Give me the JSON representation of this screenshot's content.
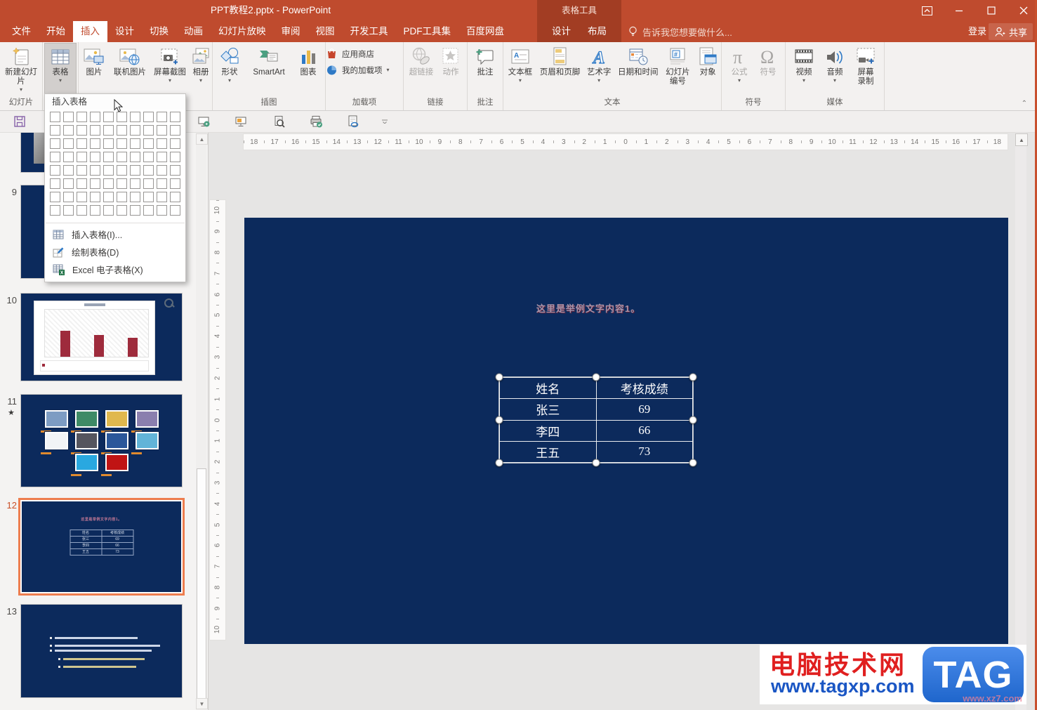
{
  "titlebar": {
    "title": "PPT教程2.pptx - PowerPoint",
    "contextual_label": "表格工具"
  },
  "tabs": {
    "items": [
      "文件",
      "开始",
      "插入",
      "设计",
      "切换",
      "动画",
      "幻灯片放映",
      "审阅",
      "视图",
      "开发工具",
      "PDF工具集",
      "百度网盘"
    ],
    "active": "插入",
    "contextual": [
      "设计",
      "布局"
    ],
    "tell_me": "告诉我您想要做什么...",
    "sign_in": "登录",
    "share": "共享"
  },
  "ribbon": {
    "groups": {
      "slides": "幻灯片",
      "illustrations": "插图",
      "addins": "加载项",
      "links": "链接",
      "comments": "批注",
      "text": "文本",
      "symbols": "符号",
      "media": "媒体"
    },
    "buttons": {
      "new_slide": "新建幻灯片",
      "table": "表格",
      "picture": "图片",
      "online_pictures": "联机图片",
      "screenshot": "屏幕截图",
      "photo_album": "相册",
      "shapes": "形状",
      "smartart": "SmartArt",
      "chart": "图表",
      "store": "应用商店",
      "my_addins": "我的加载项",
      "hyperlink": "超链接",
      "action": "动作",
      "comment": "批注",
      "text_box": "文本框",
      "header_footer": "页眉和页脚",
      "wordart": "艺术字",
      "date_time": "日期和时间",
      "slide_number": "幻灯片编号",
      "object": "对象",
      "equation": "公式",
      "symbol": "符号",
      "video": "视频",
      "audio": "音频",
      "screen_recording": "屏幕录制"
    }
  },
  "table_dropdown": {
    "header": "插入表格",
    "grid_cols": 10,
    "grid_rows": 8,
    "items": [
      "插入表格(I)...",
      "绘制表格(D)",
      "Excel 电子表格(X)"
    ]
  },
  "slide": {
    "title": "这里是举例文字内容1。",
    "table": {
      "headers": [
        "姓名",
        "考核成绩"
      ],
      "rows": [
        [
          "张三",
          "69"
        ],
        [
          "李四",
          "66"
        ],
        [
          "王五",
          "73"
        ]
      ]
    }
  },
  "thumbnails": [
    {
      "number": "",
      "type": "photo"
    },
    {
      "number": "9",
      "type": "blank"
    },
    {
      "number": "10",
      "type": "chart",
      "bars": [
        55,
        45,
        40
      ]
    },
    {
      "number": "11",
      "type": "gallery",
      "star": true,
      "colors": [
        "#7d9cc3",
        "#3e8a66",
        "#e0b84e",
        "#8a7fae",
        "#f2f4f6",
        "#55555e",
        "#2b579a",
        "#62b4d8",
        "#29a8e0",
        "#c01414"
      ]
    },
    {
      "number": "12",
      "type": "table",
      "selected": true
    },
    {
      "number": "13",
      "type": "bullets"
    }
  ],
  "rulers": {
    "h_origin": 18,
    "v_origin": 10
  },
  "watermark": {
    "site": "电脑技术网",
    "url": "www.tagxp.com",
    "logo": "TAG",
    "overlay_url": "www.xz7.com"
  },
  "colors": {
    "accent_red": "#bf4b2e",
    "contextual_red": "#a23d23",
    "slide_navy": "#0c2a5c",
    "selection_orange": "#ed7d4e",
    "chart_bar_maroon": "#9e2b3c"
  }
}
